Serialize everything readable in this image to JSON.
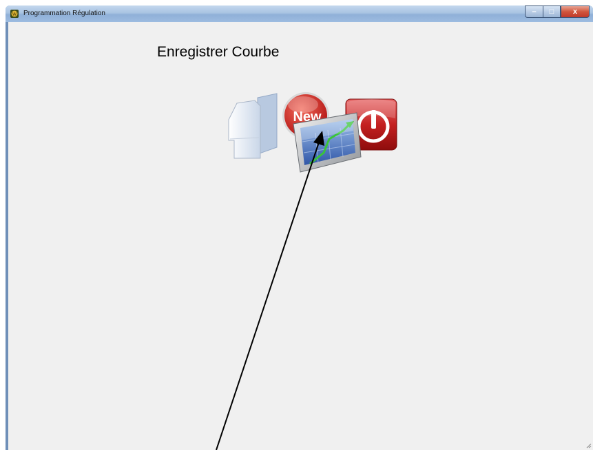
{
  "window": {
    "title": "Programmation Régulation",
    "app_icon": "app-icon",
    "controls": {
      "minimize_glyph": "–",
      "maximize_glyph": "□",
      "close_glyph": "x"
    }
  },
  "main": {
    "heading": "Enregistrer Courbe",
    "toolbar": [
      {
        "name": "open-folder-icon",
        "label": ""
      },
      {
        "name": "new-icon",
        "label": "New"
      },
      {
        "name": "curve-chart-icon",
        "label": ""
      },
      {
        "name": "power-icon",
        "label": ""
      }
    ]
  },
  "annotation": {
    "type": "arrow-pointer",
    "color": "#000000"
  }
}
